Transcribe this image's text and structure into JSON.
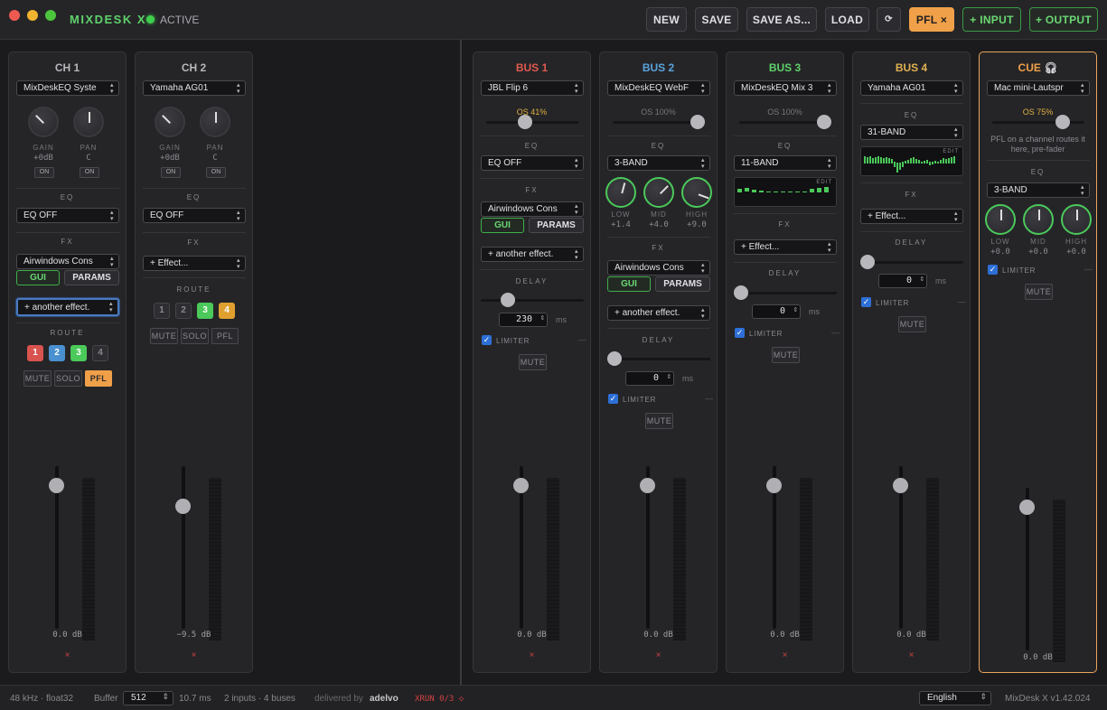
{
  "app": {
    "title": "MIXDESK X",
    "status": "ACTIVE"
  },
  "toolbar": {
    "new": "NEW",
    "save": "SAVE",
    "save_as": "SAVE AS...",
    "load": "LOAD",
    "refresh_icon": "⟳",
    "pfl": "PFL ×",
    "add_input": "+ INPUT",
    "add_output": "+ OUTPUT"
  },
  "inputs": [
    {
      "name": "CH 1",
      "device": "MixDeskEQ Syste",
      "gain_label": "GAIN",
      "gain_val": "+0dB",
      "pan_label": "PAN",
      "pan_val": "C",
      "on1": "ON",
      "on2": "ON",
      "eq_title": "EQ",
      "eq": "EQ OFF",
      "fx_title": "FX",
      "fx1": "Airwindows Cons",
      "gui": "GUI",
      "params": "PARAMS",
      "fx_add": "+ another effect.",
      "route_title": "ROUTE",
      "routes": [
        "1",
        "2",
        "3",
        "4"
      ],
      "mute": "MUTE",
      "solo": "SOLO",
      "pfl": "PFL",
      "db": "0.0 dB",
      "x": "×"
    },
    {
      "name": "CH 2",
      "device": "Yamaha AG01",
      "gain_label": "GAIN",
      "gain_val": "+0dB",
      "pan_label": "PAN",
      "pan_val": "C",
      "on1": "ON",
      "on2": "ON",
      "eq_title": "EQ",
      "eq": "EQ OFF",
      "fx_title": "FX",
      "fx_add": "+ Effect...",
      "route_title": "ROUTE",
      "routes": [
        "1",
        "2",
        "3",
        "4"
      ],
      "mute": "MUTE",
      "solo": "SOLO",
      "pfl": "PFL",
      "db": "−9.5 dB",
      "x": "×"
    }
  ],
  "buses": [
    {
      "name": "BUS 1",
      "color": "#e05a4f",
      "device": "JBL Flip 6",
      "os": "OS 41%",
      "eq_title": "EQ",
      "eq": "EQ OFF",
      "fx_title": "FX",
      "fx1": "Airwindows Cons",
      "gui": "GUI",
      "params": "PARAMS",
      "fx_add": "+ another effect.",
      "delay_title": "DELAY",
      "delay": "230",
      "ms": "ms",
      "limiter": "LIMITER",
      "dash": "—",
      "mute": "MUTE",
      "db": "0.0 dB",
      "x": "×"
    },
    {
      "name": "BUS 2",
      "color": "#5ba4dc",
      "device": "MixDeskEQ WebF",
      "os": "OS 100%",
      "eq_title": "EQ",
      "eq": "3-BAND",
      "low": "LOW",
      "mid": "MID",
      "high": "HIGH",
      "low_val": "+1.4",
      "mid_val": "+4.0",
      "high_val": "+9.0",
      "fx_title": "FX",
      "fx1": "Airwindows Cons",
      "gui": "GUI",
      "params": "PARAMS",
      "fx_add": "+ another effect.",
      "delay_title": "DELAY",
      "delay": "0",
      "ms": "ms",
      "limiter": "LIMITER",
      "dash": "—",
      "mute": "MUTE",
      "db": "0.0 dB",
      "x": "×"
    },
    {
      "name": "BUS 3",
      "color": "#5ed16a",
      "device": "MixDeskEQ Mix 3",
      "os": "OS 100%",
      "eq_title": "EQ",
      "eq": "11-BAND",
      "edit": "EDIT",
      "fx_title": "FX",
      "fx_add": "+ Effect...",
      "delay_title": "DELAY",
      "delay": "0",
      "ms": "ms",
      "limiter": "LIMITER",
      "dash": "—",
      "mute": "MUTE",
      "db": "0.0 dB",
      "x": "×"
    },
    {
      "name": "BUS 4",
      "color": "#e0b050",
      "device": "Yamaha AG01",
      "eq_title": "EQ",
      "eq": "31-BAND",
      "edit": "EDIT",
      "fx_title": "FX",
      "fx_add": "+ Effect...",
      "delay_title": "DELAY",
      "delay": "0",
      "ms": "ms",
      "limiter": "LIMITER",
      "dash": "—",
      "mute": "MUTE",
      "db": "0.0 dB",
      "x": "×"
    }
  ],
  "cue": {
    "name": "CUE",
    "icon": "headphones-icon",
    "device": "Mac mini-Lautspr",
    "os": "OS 75%",
    "hint": "PFL on a channel routes it here, pre-fader",
    "eq_title": "EQ",
    "eq": "3-BAND",
    "low": "LOW",
    "mid": "MID",
    "high": "HIGH",
    "low_val": "+0.0",
    "mid_val": "+0.0",
    "high_val": "+0.0",
    "limiter": "LIMITER",
    "dash": "—",
    "mute": "MUTE",
    "db": "0.0 dB",
    "color": "#f0a048"
  },
  "status": {
    "format": "48 kHz · float32",
    "buffer_label": "Buffer",
    "buffer": "512",
    "latency": "10.7 ms",
    "io": "2 inputs · 4 buses",
    "delivered": "delivered by",
    "brand": "adelvo",
    "xrun": "XRUN 0/3 ◇",
    "language": "English",
    "version": "MixDesk X v1.42.024"
  },
  "colors": {
    "green": "#5ed16a",
    "orange": "#f0a048",
    "route1": "#d9534f",
    "route2": "#4a90d0",
    "route3": "#4bc95a",
    "route4": "#e0a030"
  }
}
